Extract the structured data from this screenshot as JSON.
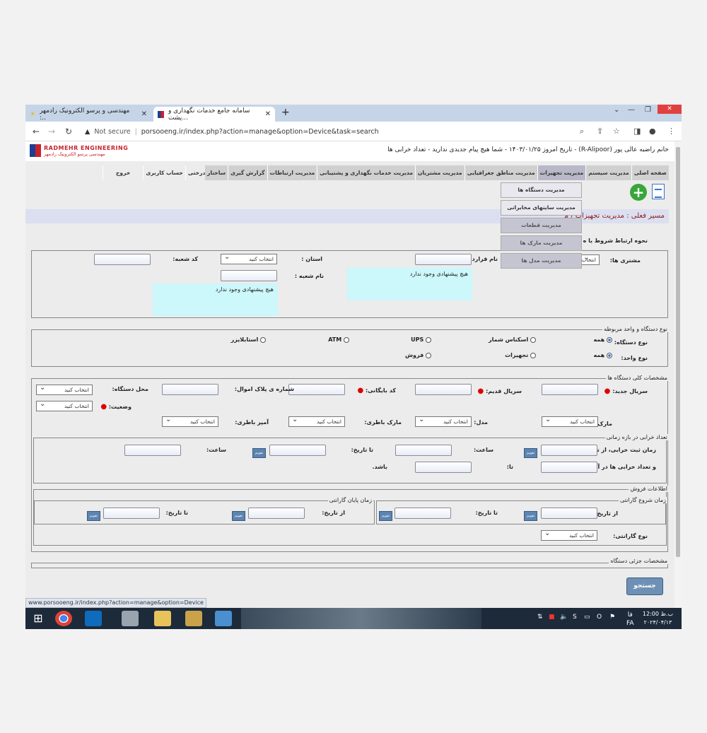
{
  "browser": {
    "tabs": [
      {
        "title": "مهندسی و پرسو الکترونیک رادمهر :..",
        "active": false
      },
      {
        "title": "سامانه جامع خدمات نگهداری و پشت...",
        "active": true
      }
    ],
    "not_secure": "Not secure",
    "url": "porsooeng.ir/index.php?action=manage&option=Device&task=search",
    "status_url": "www.porsooeng.ir/index.php?action=manage&option=Device"
  },
  "header": {
    "logo_en": "RADMEHR ENGINEERING",
    "logo_fa": "مهندسی پرسو الکترونیک رادمهر",
    "welcome": "خانم راضیه عالی پور (R-Alipoor) - تاریخ امروز ۱۴۰۳/۰۱/۲۵ - شما هیچ پیام جدیدی ندارید - تعداد خرابی ها"
  },
  "menu": {
    "items": [
      "صفحه اصلی",
      "مدیریت سیستم",
      "مدیریت تجهیزات",
      "مدیریت مناطق جغرافیایی",
      "مدیریت مشتریان",
      "مدیریت خدمات نگهداری و پشتیبانی",
      "مدیریت ارتباطات",
      "گزارش گیری",
      "ساختار درختی",
      "حساب کاربری",
      "خروج"
    ],
    "submenu": [
      "مدیریت دستگاه ها",
      "مدیریت سایتهای مخابراتی",
      "مدیریت قطعات",
      "مدیریت مارک ها",
      "مدیریت مدل ها"
    ]
  },
  "path": "مسیر فعلی : مدیریت تجهیزات / م",
  "contract_heading": "نحوه ارتباط شروط با ه",
  "customer": {
    "customer_label": "مشتری ها:",
    "customer_value": "انتخاب",
    "contract_label": "نام قرارداد:",
    "province_label": "استان :",
    "province_value": "انتخاب کنید",
    "branch_code_label": "کد شعبه:",
    "branch_name_label": "نام شعبه :",
    "no_suggestion": "هیچ پیشنهادی وجود ندارد"
  },
  "device_type": {
    "legend": "نوع دستگاه و واحد مربوطه",
    "device_label": "نوع دستگاه:",
    "unit_label": "نوع واحد:",
    "device_options": [
      "همه",
      "اسکناس شمار",
      "UPS",
      "ATM",
      "استابلایزر"
    ],
    "unit_options": [
      "همه",
      "تجهیزات",
      "فروش"
    ]
  },
  "general": {
    "legend": "مشخصات کلی دستگاه ها",
    "new_serial": "سریال جدید:",
    "old_serial": "سریال قدیم:",
    "archive_code": "کد بایگانی:",
    "asset_plate": "شماره ی پلاک اموال:",
    "device_location": "محل دستگاه:",
    "status": "وضعیت:",
    "brand": "مارک:",
    "model": "مدل:",
    "battery_brand": "مارک باطری:",
    "battery_amp": "آمپر باطری:",
    "select": "انتخاب کنید"
  },
  "failures": {
    "legend": "تعداد خرابی در بازه زمانی",
    "register_from": "زمان ثبت خرابی، از تاریخ:",
    "hour": "ساعت:",
    "to_date": "تا تاریخ:",
    "count_from": "و تعداد خرابی ها در آن، از:",
    "to": "تا:",
    "be": "باشد.",
    "cal": "تقویم"
  },
  "sales": {
    "legend": "اطلاعات فروش",
    "warranty_start": "زمان شروع گارانتی",
    "warranty_end": "زمان پایان گارانتی",
    "from_date": "از تاریخ:",
    "to_date": "تا تاریخ:",
    "warranty_type": "نوع گارانتی:",
    "select": "انتخاب کنید"
  },
  "detail_legend": "مشخصات جزئی دستگاه",
  "search_button": "جستجو",
  "taskbar": {
    "time": "12:00 ب.ظ",
    "date": "۲۰۲۴/۰۴/۱۳",
    "lang": "FA",
    "lang2": "فا"
  }
}
